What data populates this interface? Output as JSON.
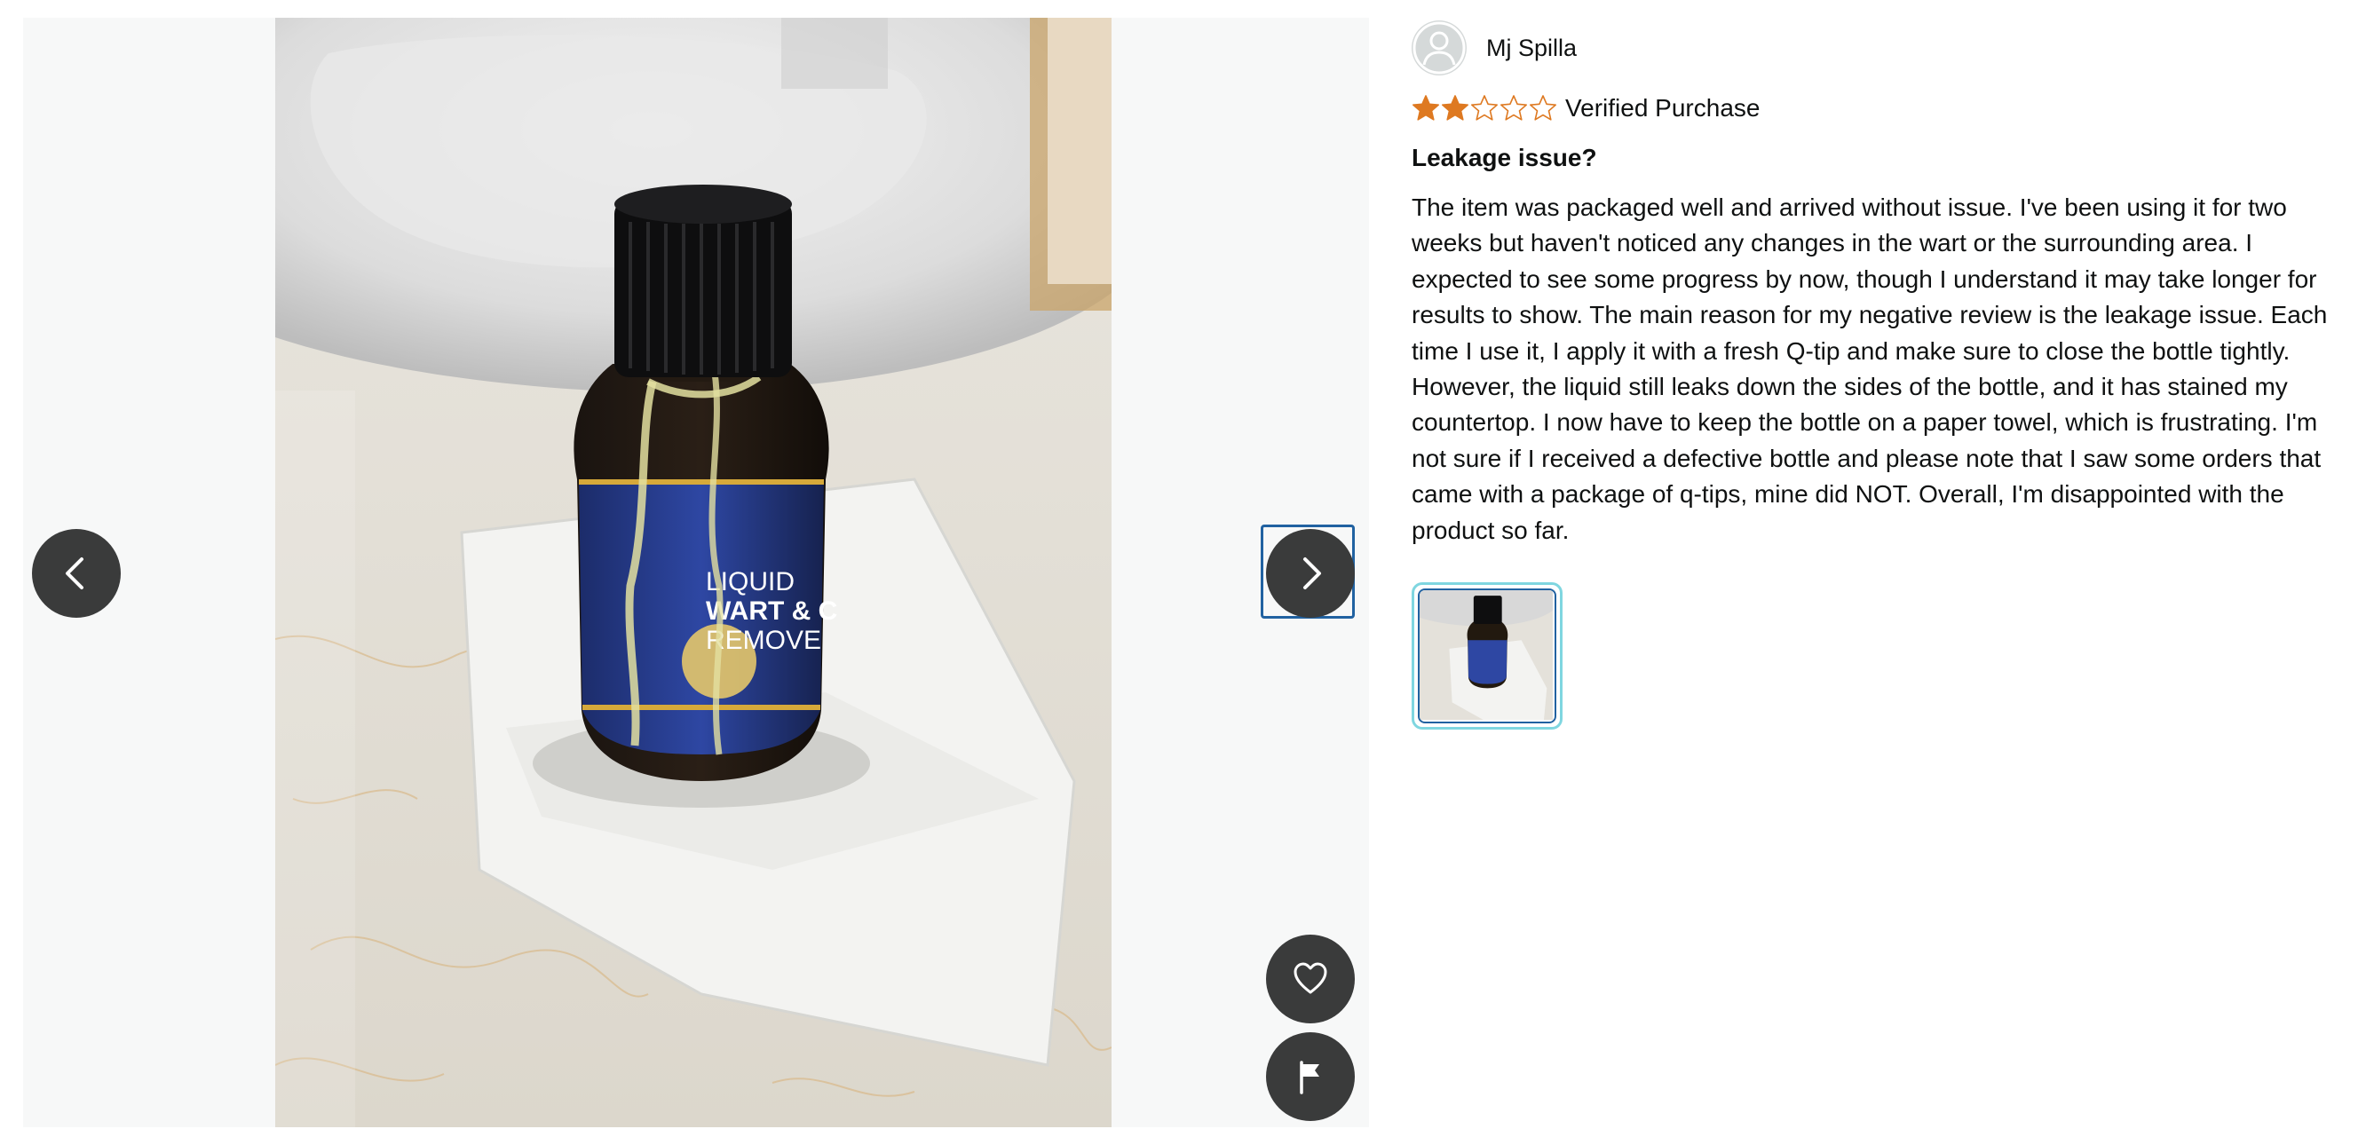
{
  "review": {
    "author": "Mj Spilla",
    "rating": 2,
    "max_rating": 5,
    "verified_label": "Verified Purchase",
    "title": "Leakage issue?",
    "body": "The item was packaged well and arrived without issue. I've been using it for two weeks but haven't noticed any changes in the wart or the surrounding area. I expected to see some progress by now, though I understand it may take longer for results to show. The main reason for my negative review is the leakage issue. Each time I use it, I apply it with a fresh Q-tip and make sure to close the bottle tightly. However, the liquid still leaks down the sides of the bottle, and it has stained my countertop. I now have to keep the bottle on a paper towel, which is frustrating. I'm not sure if I received a defective bottle and please note that I saw some orders that came with a package of q-tips, mine did NOT. Overall, I'm disappointed with the product so far."
  },
  "photo": {
    "label_lines": [
      "LIQUID",
      "WART & C",
      "REMOVE"
    ]
  },
  "colors": {
    "star_fill": "#de7921",
    "star_empty_stroke": "#de7921",
    "nav_button": "#3a3b3b",
    "focus_outline": "#2162a1",
    "thumb_ring": "#7fd6e0"
  },
  "icons": {
    "prev": "chevron-left-icon",
    "next": "chevron-right-icon",
    "like": "heart-icon",
    "report": "flag-icon",
    "avatar": "user-silhouette-icon"
  }
}
